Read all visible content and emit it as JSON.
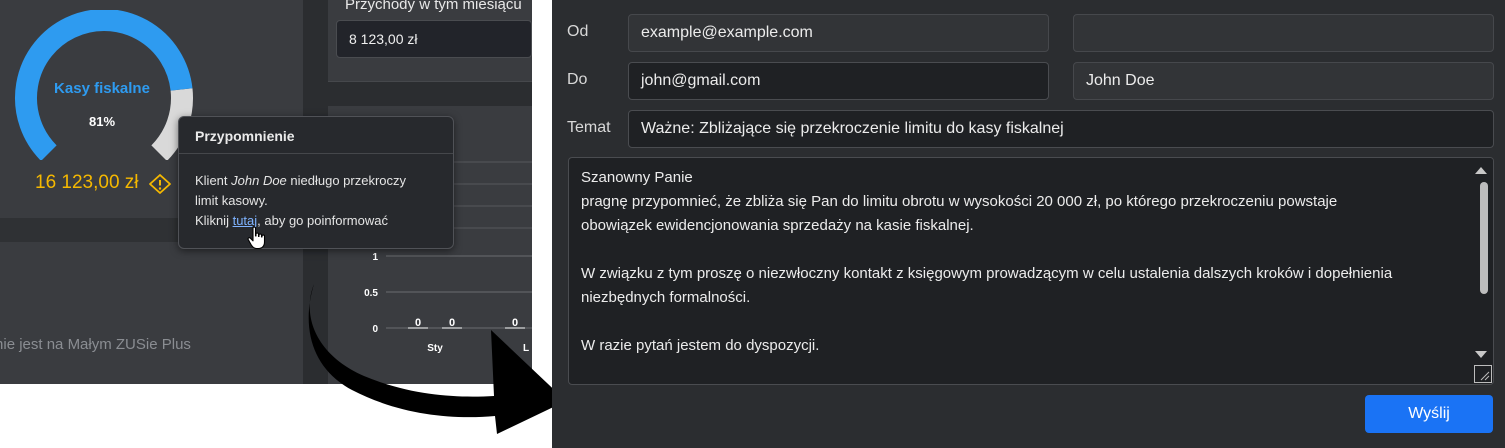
{
  "dashboard": {
    "gauge": {
      "title": "Kasy fiskalne",
      "percent_label": "81%",
      "percent_value": 0.81,
      "amount": "16 123,00 zł",
      "fill_color": "#2e9bf0",
      "rest_color": "#d9d9d9",
      "amount_color": "#f5b800"
    },
    "zus_text": "ent nie jest na Małym ZUSie Plus",
    "przychody": {
      "label": "Przychody w tym miesiącu",
      "value": "8 123,00 zł"
    },
    "tooltip": {
      "title": "Przypomnienie",
      "line1_prefix": "Klient ",
      "client_name": "John Doe",
      "line1_suffix": " niedługo przekroczy",
      "line2": "limit kasowy.",
      "line3_prefix": "Kliknij ",
      "link_text": "tutaj",
      "line3_suffix": ", aby go poinformować"
    }
  },
  "chart_data": {
    "type": "bar",
    "categories": [
      "Sty",
      "L"
    ],
    "values": [
      0,
      0,
      0
    ],
    "y_ticks": [
      "1",
      "0.5",
      "0"
    ],
    "data_labels": [
      "0",
      "0",
      "0"
    ],
    "ylim": [
      0,
      1
    ],
    "title": "",
    "xlabel": "",
    "ylabel": ""
  },
  "email": {
    "from_label": "Od",
    "from_value": "example@example.com",
    "from_name_value": "",
    "to_label": "Do",
    "to_value": "john@gmail.com",
    "to_name_value": "John Doe",
    "subject_label": "Temat",
    "subject_value": "Ważne: Zbliżające się przekroczenie limitu do kasy fiskalnej",
    "body_lines": [
      "Szanowny Panie",
      "pragnę przypomnieć, że zbliża się Pan do limitu obrotu w wysokości 20 000 zł, po którego przekroczeniu powstaje",
      "obowiązek ewidencjonowania sprzedaży na kasie fiskalnej.",
      "",
      "W związku z tym proszę o niezwłoczny kontakt z księgowym prowadzącym w celu ustalenia dalszych kroków i dopełnienia",
      "niezbędnych formalności.",
      "",
      "W razie pytań jestem do dyspozycji."
    ],
    "send_label": "Wyślij",
    "accent": "#1a73f5"
  }
}
